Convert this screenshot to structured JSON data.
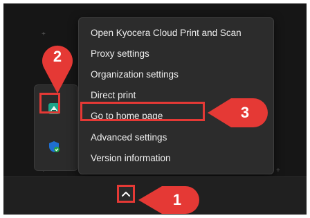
{
  "context_menu": {
    "items": [
      {
        "label": "Open Kyocera Cloud Print and Scan"
      },
      {
        "label": "Proxy settings"
      },
      {
        "label": "Organization settings"
      },
      {
        "label": "Direct print"
      },
      {
        "label": "Go to home page"
      },
      {
        "label": "Advanced settings"
      },
      {
        "label": "Version information"
      }
    ]
  },
  "callouts": {
    "step1": "1",
    "step2": "2",
    "step3": "3"
  },
  "tray": {
    "icons": [
      "kyocera-cloud-print-icon",
      "windows-security-icon"
    ],
    "overflow_button_icon": "chevron-up-icon"
  },
  "colors": {
    "callout_red": "#e53935",
    "menu_background": "#2c2c2c",
    "desktop_background": "#161616",
    "taskbar_background": "#202020"
  }
}
